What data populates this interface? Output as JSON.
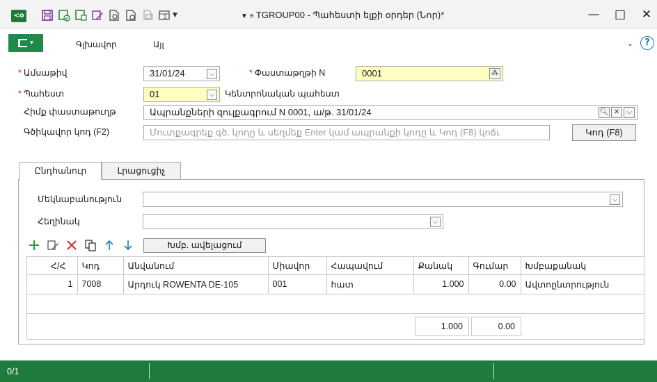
{
  "window": {
    "app_icon_text": "<o",
    "title": "TGROUP00 - Պահեստի ելքի օրդեր (Նոր)*",
    "title_prefix": "▼ ≡",
    "minimize": "—",
    "maximize": "□",
    "close": "✕"
  },
  "menu": {
    "main_caret": "▾",
    "items": [
      "Գլխավոր",
      "Այլ"
    ],
    "right_chevron": "⌄",
    "help": "?"
  },
  "form": {
    "date_label": "Ամսաթիվ",
    "date_value": "31/01/24",
    "docnum_label": "Փաստաթղթի N",
    "docnum_value": "0001",
    "warehouse_label": "Պահեստ",
    "warehouse_code": "01",
    "warehouse_name": "Կենտրոնական պահեստ",
    "basedoc_label": "Հիմք փաստաթուղթ",
    "basedoc_value": "Ապրանքների զուլքագրում N 0001, ա/թ.  31/01/24",
    "barcode_label": "Գծիկավոր կոդ (F2)",
    "barcode_placeholder": "Մուտքագրեք գծ. կոդը և սեղմեք Enter կամ ապրանքի կոդը և Կոդ (F8) կոճւ",
    "code_button": "Կոդ (F8)",
    "required_mark": "*"
  },
  "tabs": [
    {
      "label": "Ընդհանուր",
      "active": true
    },
    {
      "label": "Լրացուցիչ",
      "active": false
    }
  ],
  "general": {
    "comment_label": "Մեկնաբանություն",
    "author_label": "Հեղինակ"
  },
  "grid_toolbar": {
    "group_add_button": "Խմբ. ավելացում"
  },
  "table": {
    "columns": [
      "Հ/Հ",
      "Կոդ",
      "Անվանում",
      "Միավոր",
      "Հապավում",
      "Քանակ",
      "Գումար",
      "Խմբաքանակ"
    ],
    "rows": [
      {
        "n": "1",
        "code": "7008",
        "name": "Արդուկ ROWENTA DE-105",
        "unit": "001",
        "abbr": "հատ",
        "qty": "1.000",
        "sum": "0.00",
        "batch": "Ավտոընտրություն"
      }
    ],
    "total_qty": "1.000",
    "total_sum": "0.00"
  },
  "status": {
    "record": "0/1"
  },
  "colors": {
    "accent_green": "#1f7a3d",
    "required_red": "#e02020",
    "yellow_field": "#fefec0"
  }
}
